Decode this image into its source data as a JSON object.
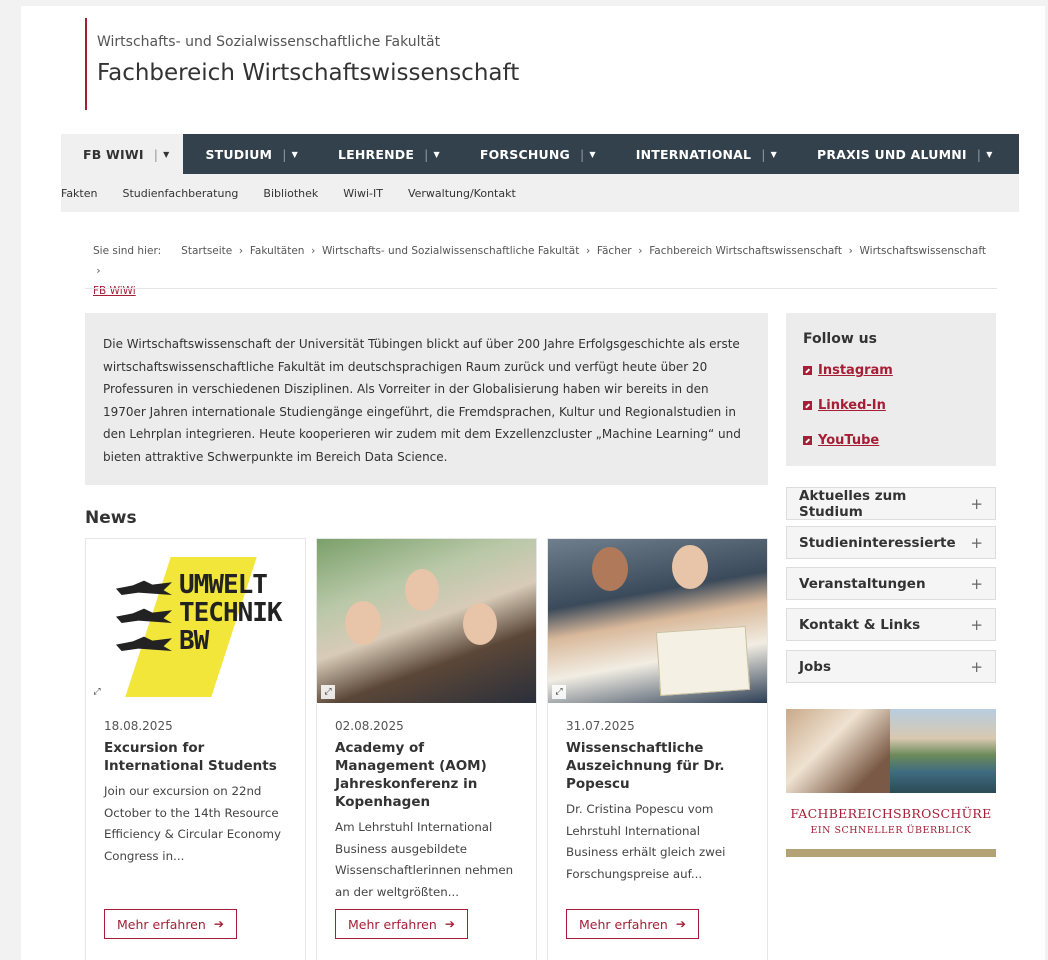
{
  "header": {
    "faculty": "Wirtschafts- und Sozialwissenschaftliche Fakultät",
    "department": "Fachbereich Wirtschaftswissenschaft"
  },
  "main_nav": [
    {
      "label": "FB WIWI"
    },
    {
      "label": "STUDIUM"
    },
    {
      "label": "LEHRENDE"
    },
    {
      "label": "FORSCHUNG"
    },
    {
      "label": "INTERNATIONAL"
    },
    {
      "label": "PRAXIS UND ALUMNI"
    }
  ],
  "sub_nav": [
    "Fakten",
    "Studienfachberatung",
    "Bibliothek",
    "Wiwi-IT",
    "Verwaltung/Kontakt"
  ],
  "breadcrumb": {
    "prefix": "Sie sind hier:",
    "items": [
      "Startseite",
      "Fakultäten",
      "Wirtschafts- und Sozialwissenschaftliche Fakultät",
      "Fächer",
      "Fachbereich Wirtschaftswissenschaft",
      "Wirtschaftswissenschaft"
    ],
    "current": "FB WiWi"
  },
  "intro": "Die Wirtschaftswissenschaft der Universität Tübingen blickt auf über 200 Jahre Erfolgsgeschichte als erste wirtschaftswissenschaftliche Fakultät im deutschsprachigen Raum zurück und verfügt heute über 20 Professuren in verschiedenen Disziplinen. Als Vorreiter in der Globalisierung haben wir bereits in den 1970er Jahren internationale Studiengänge eingeführt, die Fremdsprachen, Kultur und Regionalstudien in den Lehrplan integrieren. Heute kooperieren wir zudem mit dem Exzellenzcluster „Machine Learning“ und bieten attraktive Schwerpunkte im Bereich Data Science.",
  "follow": {
    "title": "Follow us",
    "links": [
      "Instagram",
      "Linked-In",
      "YouTube"
    ]
  },
  "accordion": [
    "Aktuelles zum Studium",
    "Studieninteressierte",
    "Veranstaltungen",
    "Kontakt & Links",
    "Jobs"
  ],
  "brochure": {
    "title": "Fachbereichsbroschüre",
    "subtitle": "EIN SCHNELLER ÜBERBLICK"
  },
  "news": {
    "heading": "News",
    "button_label": "Mehr erfahren",
    "logo_lines": [
      "UMWELT",
      "TECHNIK",
      "BW"
    ],
    "items": [
      {
        "date": "18.08.2025",
        "title": "Excursion for International Students",
        "teaser": "Join our excursion on 22nd October to the 14th Resource Efficiency & Circular Economy Congress in..."
      },
      {
        "date": "02.08.2025",
        "title": "Academy of Management (AOM) Jahreskonferenz in Kopenhagen",
        "teaser": "Am Lehrstuhl International Business ausgebildete Wissenschaftlerinnen nehmen an der weltgrößten..."
      },
      {
        "date": "31.07.2025",
        "title": "Wissenschaftliche Auszeichnung für Dr. Popescu",
        "teaser": "Dr. Cristina Popescu vom Lehrstuhl International Business erhält gleich zwei Forschungspreise auf..."
      }
    ]
  },
  "colors": {
    "accent": "#a51e36",
    "nav_bg": "#32414b",
    "gold": "#b3a274"
  }
}
